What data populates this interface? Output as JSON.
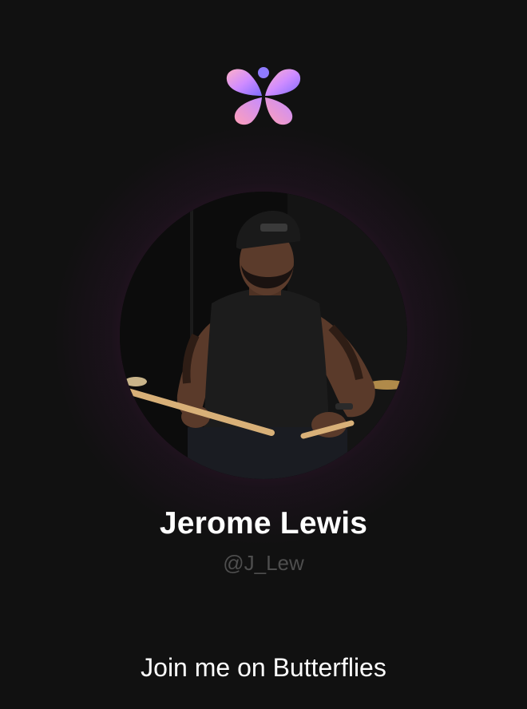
{
  "app": {
    "logo_icon": "butterfly-logo-icon",
    "brand_gradient": [
      "#f5a7c6",
      "#c98bff",
      "#7c6bff"
    ]
  },
  "profile": {
    "display_name": "Jerome Lewis",
    "handle": "@J_Lew",
    "avatar_icon": "profile-photo"
  },
  "footer": {
    "cta_text": "Join me on Butterflies"
  },
  "colors": {
    "background": "#111111",
    "handle": "#4e4e4e",
    "glow": "#8a2a6e"
  }
}
